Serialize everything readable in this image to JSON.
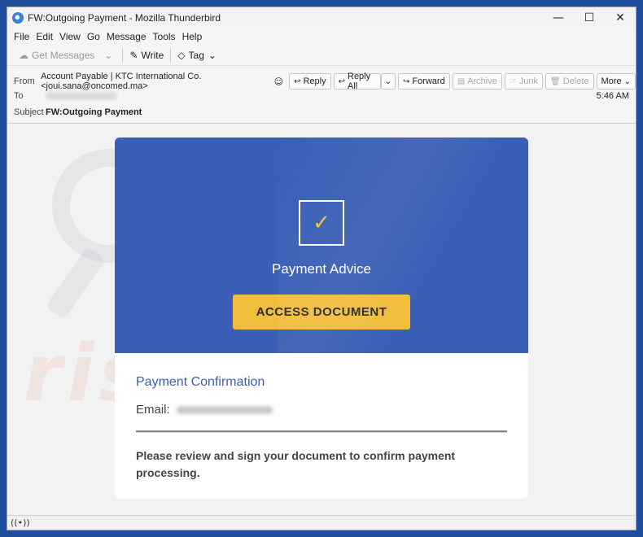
{
  "window": {
    "title": "FW:Outgoing Payment - Mozilla Thunderbird",
    "controls": {
      "minimize": "—",
      "maximize": "☐",
      "close": "✕"
    }
  },
  "menu": {
    "items": [
      "File",
      "Edit",
      "View",
      "Go",
      "Message",
      "Tools",
      "Help"
    ]
  },
  "toolbar": {
    "get_messages": "Get Messages",
    "write": "Write",
    "tag": "Tag"
  },
  "headers": {
    "from_label": "From",
    "from_value": "Account Payable | KTC International Co. <joui.sana@oncomed.ma>",
    "to_label": "To",
    "subject_label": "Subject",
    "subject_value": "FW:Outgoing Payment",
    "time": "5:46 AM",
    "actions": {
      "reply": "Reply",
      "reply_all": "Reply All",
      "forward": "Forward",
      "archive": "Archive",
      "junk": "Junk",
      "delete": "Delete",
      "more": "More"
    }
  },
  "email": {
    "advice_title": "Payment Advice",
    "access_button": "ACCESS DOCUMENT",
    "confirmation_title": "Payment Confirmation",
    "email_label": "Email:",
    "review_text": "Please review and sign your document to confirm payment processing."
  },
  "watermark": {
    "text": "risk.com"
  },
  "colors": {
    "desktop": "#1f4f9c",
    "card_banner": "#3a5fb6",
    "access_button": "#f1bd3c",
    "checkmark": "#f2c33c",
    "confirmation_title": "#3a5fb6"
  }
}
